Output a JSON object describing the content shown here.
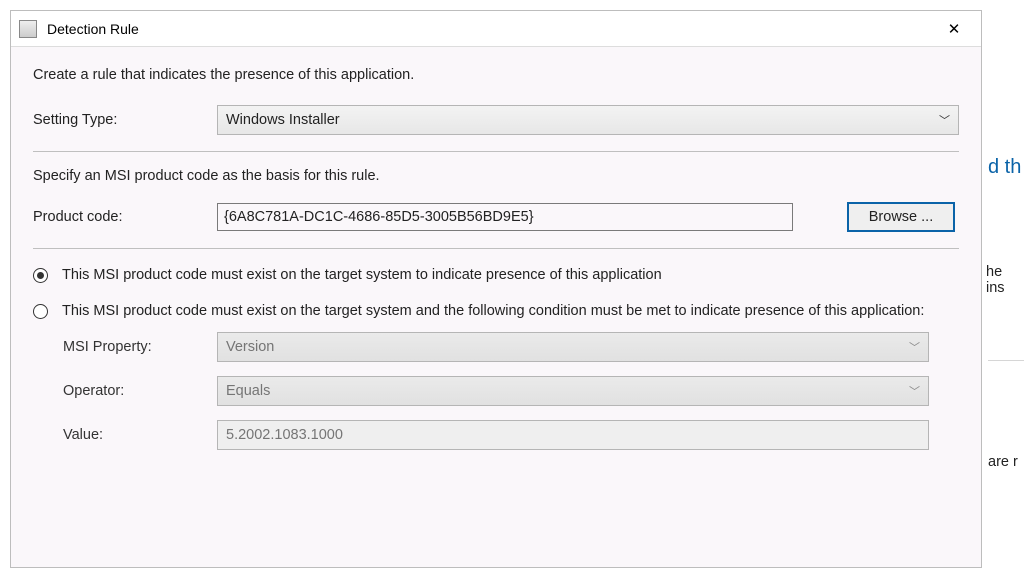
{
  "titlebar": {
    "title": "Detection Rule"
  },
  "instructions": {
    "create_rule": "Create a rule that indicates the presence of this application.",
    "specify_msi": "Specify an MSI product code as the basis for this rule."
  },
  "labels": {
    "setting_type": "Setting Type:",
    "product_code": "Product code:",
    "browse": "Browse ...",
    "msi_property": "MSI Property:",
    "operator": "Operator:",
    "value": "Value:"
  },
  "fields": {
    "setting_type_value": "Windows Installer",
    "product_code_value": "{6A8C781A-DC1C-4686-85D5-3005B56BD9E5}",
    "msi_property_value": "Version",
    "operator_value": "Equals",
    "value_value": "5.2002.1083.1000"
  },
  "radios": {
    "selected": 0,
    "option1": "This MSI product code must exist on the target system to indicate presence of this application",
    "option2": "This MSI product code must exist on the target system and the following condition must be met to indicate presence of this application:"
  },
  "right_fragments": {
    "link_frag": "d th",
    "he_ins": "he ins",
    "are_r": "are r"
  }
}
